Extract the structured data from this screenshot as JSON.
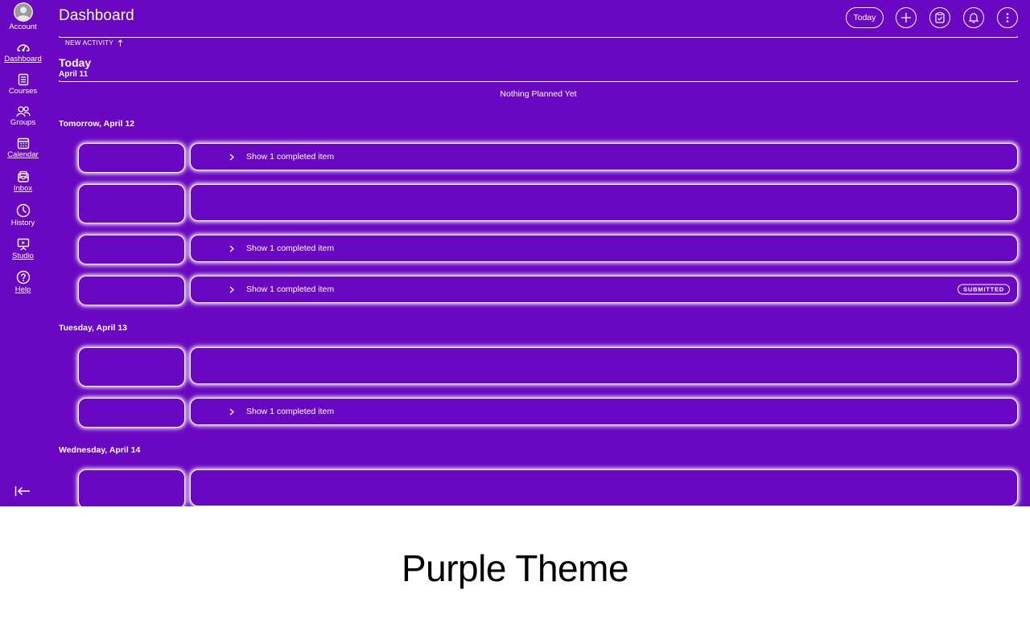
{
  "colors": {
    "background": "#6a07c2",
    "foreground": "#ffffff",
    "caption_bg": "#ffffff",
    "caption_text": "#000000"
  },
  "sidebar": {
    "items": [
      {
        "label": "Account",
        "icon": "account-avatar-icon"
      },
      {
        "label": "Dashboard",
        "icon": "dashboard-gauge-icon"
      },
      {
        "label": "Courses",
        "icon": "courses-book-icon"
      },
      {
        "label": "Groups",
        "icon": "groups-people-icon"
      },
      {
        "label": "Calendar",
        "icon": "calendar-icon"
      },
      {
        "label": "Inbox",
        "icon": "inbox-icon"
      },
      {
        "label": "History",
        "icon": "history-clock-icon"
      },
      {
        "label": "Studio",
        "icon": "studio-icon"
      },
      {
        "label": "Help",
        "icon": "help-icon"
      }
    ],
    "collapse_icon": "collapse-sidebar-icon"
  },
  "header": {
    "title": "Dashboard",
    "today_button": "Today",
    "actions": [
      "add-icon",
      "todo-list-icon",
      "notifications-bell-icon",
      "more-options-icon"
    ]
  },
  "new_activity": "NEW ACTIVITY",
  "today": {
    "heading": "Today",
    "date": "April 11",
    "empty_message": "Nothing Planned Yet"
  },
  "days": [
    {
      "heading": "Tomorrow, April 12",
      "items": [
        {
          "completed_text": "Show 1 completed item",
          "badge": ""
        },
        {
          "completed_text": "",
          "badge": ""
        },
        {
          "completed_text": "Show 1 completed item",
          "badge": ""
        },
        {
          "completed_text": "Show 1 completed item",
          "badge": "SUBMITTED"
        }
      ]
    },
    {
      "heading": "Tuesday, April 13",
      "items": [
        {
          "completed_text": "",
          "badge": ""
        },
        {
          "completed_text": "Show 1 completed item",
          "badge": ""
        }
      ]
    },
    {
      "heading": "Wednesday, April 14",
      "items": [
        {
          "completed_text": "",
          "badge": ""
        }
      ]
    }
  ],
  "caption": "Purple Theme"
}
